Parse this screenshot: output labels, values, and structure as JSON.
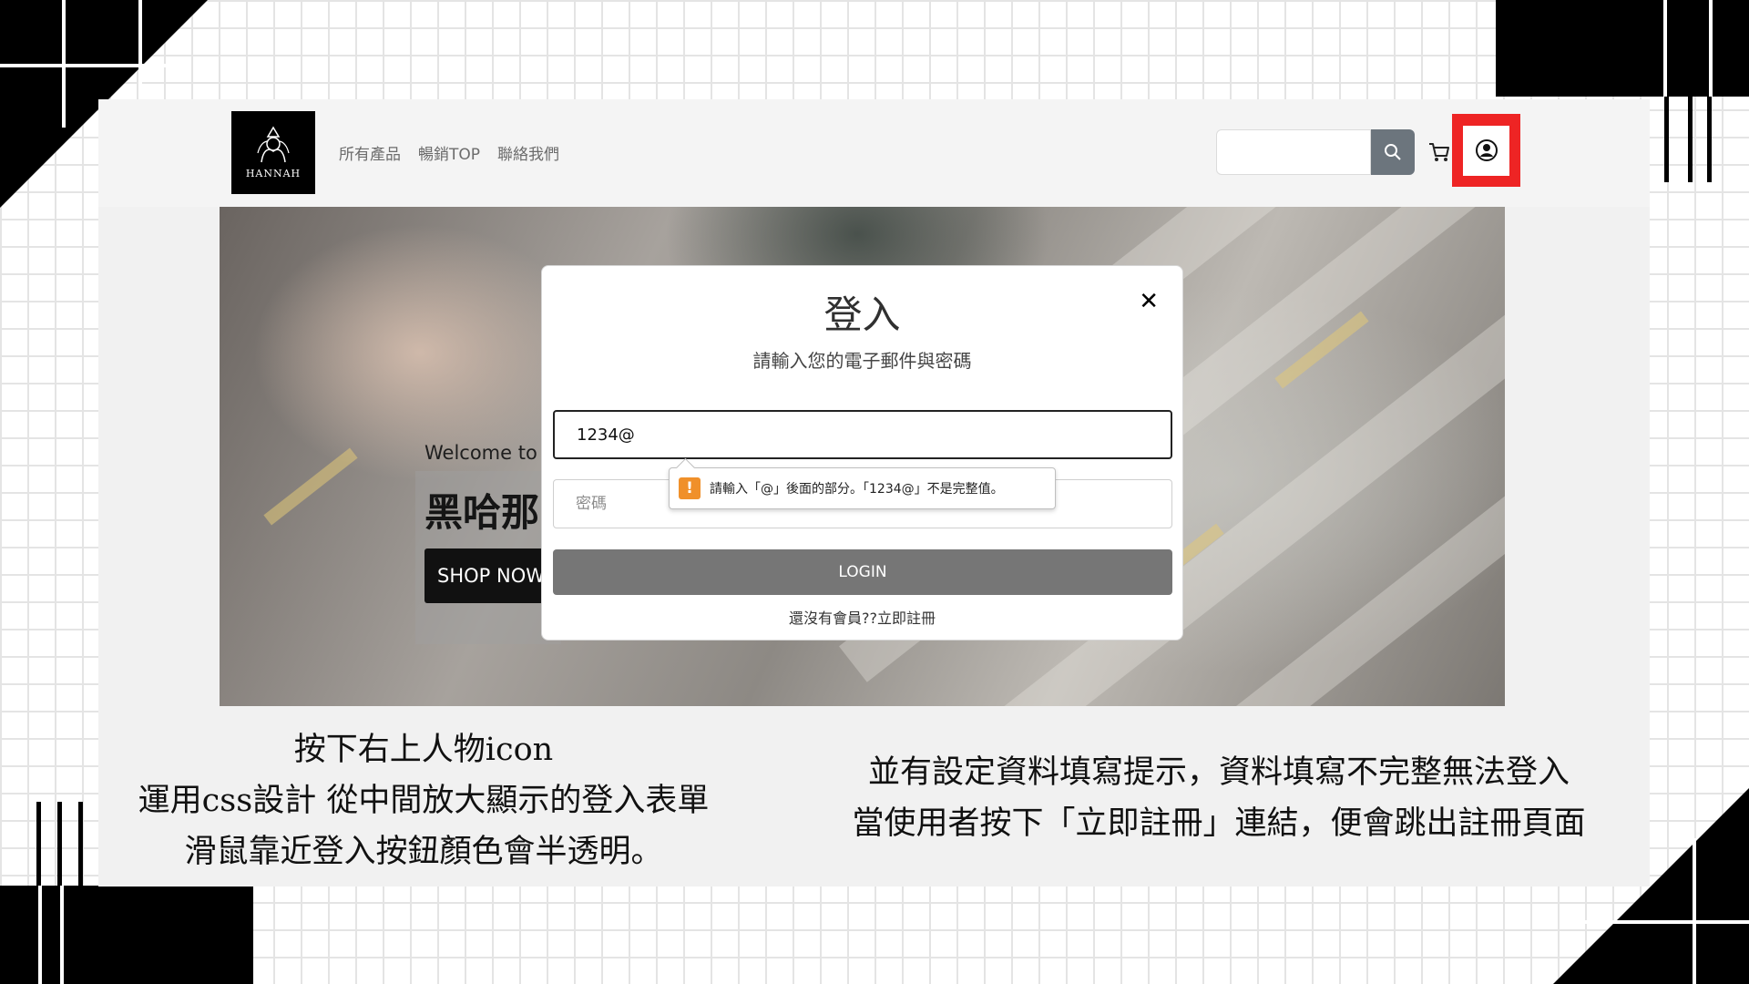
{
  "nav": {
    "logo_text": "HANNAH",
    "links": [
      "所有產品",
      "暢銷TOP",
      "聯絡我們"
    ],
    "search_value": ""
  },
  "hero": {
    "welcome": "Welcome to",
    "title": "黑哈那",
    "shop_button": "SHOP NOW"
  },
  "modal": {
    "title": "登入",
    "subtitle": "請輸入您的電子郵件與密碼",
    "email_value": "1234@",
    "password_placeholder": "密碼",
    "validation_message": "請輸入「@」後面的部分。「1234@」不是完整值。",
    "login_button": "LOGIN",
    "register_link": "還沒有會員??立即註冊"
  },
  "captions": {
    "left": [
      "按下右上人物icon",
      "運用css設計 從中間放大顯示的登入表單",
      "滑鼠靠近登入按鈕顏色會半透明。"
    ],
    "right": [
      "並有設定資料填寫提示，資料填寫不完整無法登入",
      "當使用者按下「立即註冊」連結，便會跳出註冊頁面"
    ]
  },
  "colors": {
    "highlight": "#ee2424",
    "search_button": "#6c757d",
    "login_button": "#767676",
    "warning": "#f0902a"
  }
}
